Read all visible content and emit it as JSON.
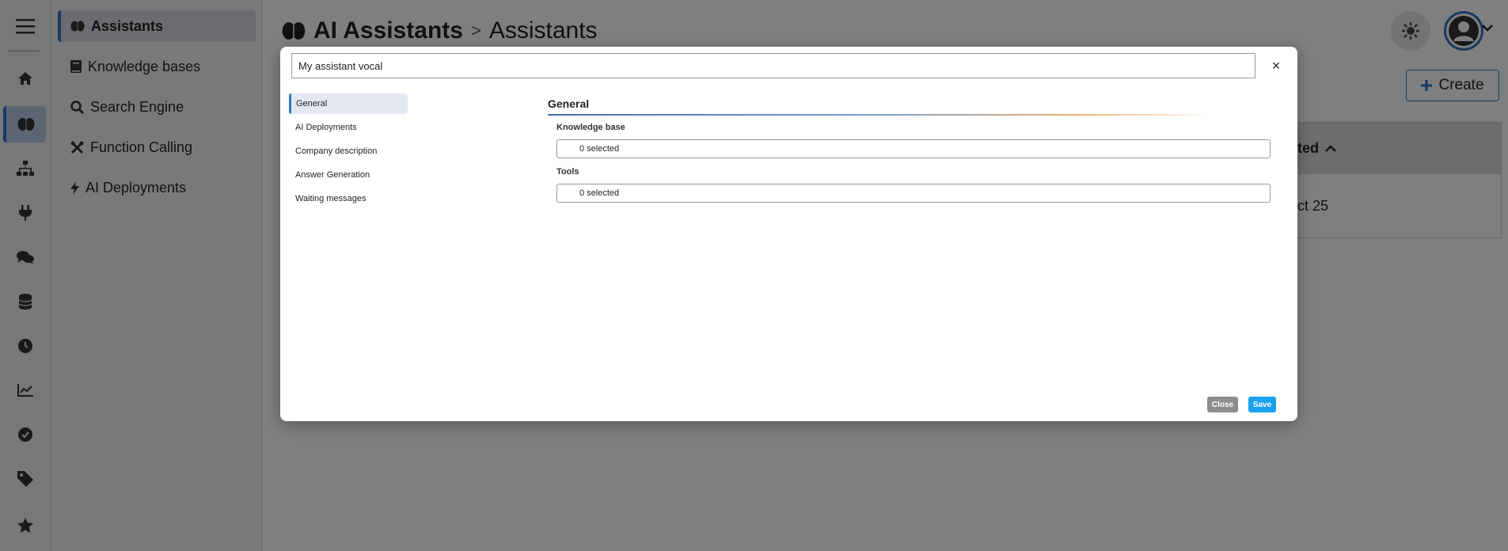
{
  "rail": {
    "icons": [
      "menu-icon",
      "home-icon",
      "brain-icon",
      "sitemap-icon",
      "plug-icon",
      "comments-icon",
      "database-icon",
      "clock-icon",
      "chart-line-icon",
      "check-circle-icon",
      "tag-icon",
      "star-icon"
    ],
    "active_index": 2
  },
  "sidebar": {
    "items": [
      {
        "label": "Assistants",
        "icon": "brain-icon"
      },
      {
        "label": "Knowledge bases",
        "icon": "book-icon"
      },
      {
        "label": "Search Engine",
        "icon": "search-icon"
      },
      {
        "label": "Function Calling",
        "icon": "tools-icon"
      },
      {
        "label": "AI Deployments",
        "icon": "bolt-icon"
      }
    ],
    "active_index": 0
  },
  "header": {
    "app_title": "AI Assistants",
    "separator": ">",
    "current": "Assistants"
  },
  "toolbar": {
    "create_label": "Create"
  },
  "background_table": {
    "header_partial": "ted",
    "row_partial": "ct 25"
  },
  "modal": {
    "name_value": "My assistant vocal",
    "nav": [
      {
        "label": "General"
      },
      {
        "label": "AI Deployments"
      },
      {
        "label": "Company description"
      },
      {
        "label": "Answer Generation"
      },
      {
        "label": "Waiting messages"
      }
    ],
    "nav_active_index": 0,
    "section_title": "General",
    "fields": [
      {
        "label": "Knowledge base",
        "value": "0 selected"
      },
      {
        "label": "Tools",
        "value": "0 selected"
      }
    ],
    "close_label": "Close",
    "save_label": "Save",
    "close_icon_glyph": "×"
  },
  "colors": {
    "accent": "#2f74c0",
    "save": "#1aa0f0",
    "close": "#8e8e8e",
    "overlay": "rgba(0,0,0,0.5)"
  }
}
